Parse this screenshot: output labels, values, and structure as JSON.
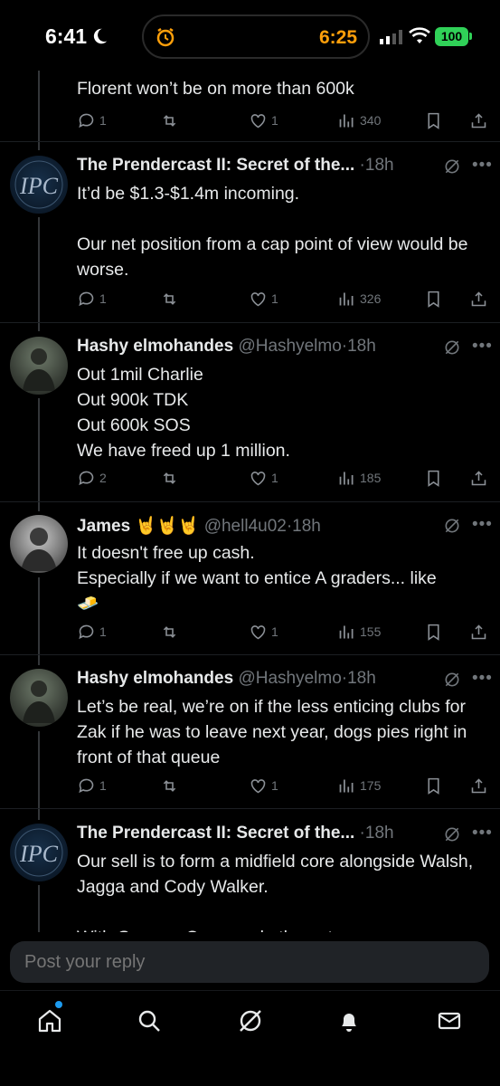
{
  "status_bar": {
    "time": "6:41",
    "timer": "6:25",
    "battery": "100"
  },
  "tweets": [
    {
      "body_lines": "Florent won’t be on more than 600k",
      "replies": "1",
      "reposts": "",
      "likes": "1",
      "views": "340"
    },
    {
      "name": "The Prendercast II: Secret of the...",
      "handle": "",
      "age": "18h",
      "body": "It’d be $1.3-$1.4m incoming.\n\nOur net position from a cap point of view would be worse.",
      "replies": "1",
      "likes": "1",
      "views": "326"
    },
    {
      "name": "Hashy elmohandes",
      "handle": "@Hashyelmo",
      "age": "18h",
      "body": "Out 1mil Charlie\nOut 900k TDK\nOut 600k SOS\nWe have freed up 1 million.",
      "replies": "2",
      "likes": "1",
      "views": "185"
    },
    {
      "name": "James 🤘🤘🤘",
      "handle": "@hell4u02",
      "age": "18h",
      "body": "It doesn't free up cash.\nEspecially if we want to entice A graders... like\n🧈",
      "replies": "1",
      "likes": "1",
      "views": "155"
    },
    {
      "name": "Hashy elmohandes",
      "handle": "@Hashyelmo",
      "age": "18h",
      "body": "Let’s be real, we’re on if the less enticing clubs for Zak if he was to leave next year, dogs pies right in front of that queue",
      "replies": "1",
      "likes": "1",
      "views": "175"
    },
    {
      "name": "The Prendercast II: Secret of the...",
      "handle": "",
      "age": "18h",
      "body": "Our sell is to form a midfield core alongside Walsh, Jagga and Cody Walker.\n\nWith George, Cerra and others, too..."
    }
  ],
  "reply_box": {
    "placeholder": "Post your reply"
  },
  "icons": {
    "tabs": [
      "home-icon",
      "search-icon",
      "grok-icon",
      "notifications-icon",
      "messages-icon"
    ]
  },
  "colors": {
    "background": "#000000",
    "text": "#e7e9ea",
    "muted": "#71767b",
    "timer": "#ff9f0a",
    "battery": "#30d158",
    "accent": "#1d9bf0"
  }
}
